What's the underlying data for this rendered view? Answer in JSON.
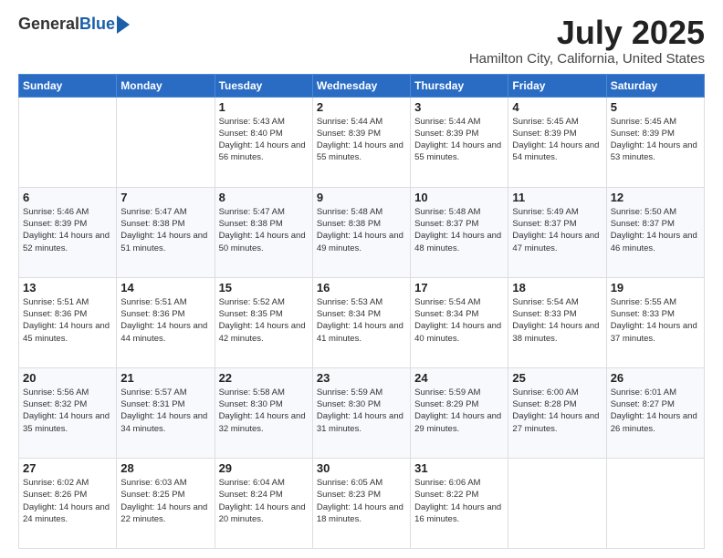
{
  "logo": {
    "general": "General",
    "blue": "Blue"
  },
  "header": {
    "month": "July 2025",
    "location": "Hamilton City, California, United States"
  },
  "weekdays": [
    "Sunday",
    "Monday",
    "Tuesday",
    "Wednesday",
    "Thursday",
    "Friday",
    "Saturday"
  ],
  "weeks": [
    [
      {
        "day": "",
        "sunrise": "",
        "sunset": "",
        "daylight": ""
      },
      {
        "day": "",
        "sunrise": "",
        "sunset": "",
        "daylight": ""
      },
      {
        "day": "1",
        "sunrise": "Sunrise: 5:43 AM",
        "sunset": "Sunset: 8:40 PM",
        "daylight": "Daylight: 14 hours and 56 minutes."
      },
      {
        "day": "2",
        "sunrise": "Sunrise: 5:44 AM",
        "sunset": "Sunset: 8:39 PM",
        "daylight": "Daylight: 14 hours and 55 minutes."
      },
      {
        "day": "3",
        "sunrise": "Sunrise: 5:44 AM",
        "sunset": "Sunset: 8:39 PM",
        "daylight": "Daylight: 14 hours and 55 minutes."
      },
      {
        "day": "4",
        "sunrise": "Sunrise: 5:45 AM",
        "sunset": "Sunset: 8:39 PM",
        "daylight": "Daylight: 14 hours and 54 minutes."
      },
      {
        "day": "5",
        "sunrise": "Sunrise: 5:45 AM",
        "sunset": "Sunset: 8:39 PM",
        "daylight": "Daylight: 14 hours and 53 minutes."
      }
    ],
    [
      {
        "day": "6",
        "sunrise": "Sunrise: 5:46 AM",
        "sunset": "Sunset: 8:39 PM",
        "daylight": "Daylight: 14 hours and 52 minutes."
      },
      {
        "day": "7",
        "sunrise": "Sunrise: 5:47 AM",
        "sunset": "Sunset: 8:38 PM",
        "daylight": "Daylight: 14 hours and 51 minutes."
      },
      {
        "day": "8",
        "sunrise": "Sunrise: 5:47 AM",
        "sunset": "Sunset: 8:38 PM",
        "daylight": "Daylight: 14 hours and 50 minutes."
      },
      {
        "day": "9",
        "sunrise": "Sunrise: 5:48 AM",
        "sunset": "Sunset: 8:38 PM",
        "daylight": "Daylight: 14 hours and 49 minutes."
      },
      {
        "day": "10",
        "sunrise": "Sunrise: 5:48 AM",
        "sunset": "Sunset: 8:37 PM",
        "daylight": "Daylight: 14 hours and 48 minutes."
      },
      {
        "day": "11",
        "sunrise": "Sunrise: 5:49 AM",
        "sunset": "Sunset: 8:37 PM",
        "daylight": "Daylight: 14 hours and 47 minutes."
      },
      {
        "day": "12",
        "sunrise": "Sunrise: 5:50 AM",
        "sunset": "Sunset: 8:37 PM",
        "daylight": "Daylight: 14 hours and 46 minutes."
      }
    ],
    [
      {
        "day": "13",
        "sunrise": "Sunrise: 5:51 AM",
        "sunset": "Sunset: 8:36 PM",
        "daylight": "Daylight: 14 hours and 45 minutes."
      },
      {
        "day": "14",
        "sunrise": "Sunrise: 5:51 AM",
        "sunset": "Sunset: 8:36 PM",
        "daylight": "Daylight: 14 hours and 44 minutes."
      },
      {
        "day": "15",
        "sunrise": "Sunrise: 5:52 AM",
        "sunset": "Sunset: 8:35 PM",
        "daylight": "Daylight: 14 hours and 42 minutes."
      },
      {
        "day": "16",
        "sunrise": "Sunrise: 5:53 AM",
        "sunset": "Sunset: 8:34 PM",
        "daylight": "Daylight: 14 hours and 41 minutes."
      },
      {
        "day": "17",
        "sunrise": "Sunrise: 5:54 AM",
        "sunset": "Sunset: 8:34 PM",
        "daylight": "Daylight: 14 hours and 40 minutes."
      },
      {
        "day": "18",
        "sunrise": "Sunrise: 5:54 AM",
        "sunset": "Sunset: 8:33 PM",
        "daylight": "Daylight: 14 hours and 38 minutes."
      },
      {
        "day": "19",
        "sunrise": "Sunrise: 5:55 AM",
        "sunset": "Sunset: 8:33 PM",
        "daylight": "Daylight: 14 hours and 37 minutes."
      }
    ],
    [
      {
        "day": "20",
        "sunrise": "Sunrise: 5:56 AM",
        "sunset": "Sunset: 8:32 PM",
        "daylight": "Daylight: 14 hours and 35 minutes."
      },
      {
        "day": "21",
        "sunrise": "Sunrise: 5:57 AM",
        "sunset": "Sunset: 8:31 PM",
        "daylight": "Daylight: 14 hours and 34 minutes."
      },
      {
        "day": "22",
        "sunrise": "Sunrise: 5:58 AM",
        "sunset": "Sunset: 8:30 PM",
        "daylight": "Daylight: 14 hours and 32 minutes."
      },
      {
        "day": "23",
        "sunrise": "Sunrise: 5:59 AM",
        "sunset": "Sunset: 8:30 PM",
        "daylight": "Daylight: 14 hours and 31 minutes."
      },
      {
        "day": "24",
        "sunrise": "Sunrise: 5:59 AM",
        "sunset": "Sunset: 8:29 PM",
        "daylight": "Daylight: 14 hours and 29 minutes."
      },
      {
        "day": "25",
        "sunrise": "Sunrise: 6:00 AM",
        "sunset": "Sunset: 8:28 PM",
        "daylight": "Daylight: 14 hours and 27 minutes."
      },
      {
        "day": "26",
        "sunrise": "Sunrise: 6:01 AM",
        "sunset": "Sunset: 8:27 PM",
        "daylight": "Daylight: 14 hours and 26 minutes."
      }
    ],
    [
      {
        "day": "27",
        "sunrise": "Sunrise: 6:02 AM",
        "sunset": "Sunset: 8:26 PM",
        "daylight": "Daylight: 14 hours and 24 minutes."
      },
      {
        "day": "28",
        "sunrise": "Sunrise: 6:03 AM",
        "sunset": "Sunset: 8:25 PM",
        "daylight": "Daylight: 14 hours and 22 minutes."
      },
      {
        "day": "29",
        "sunrise": "Sunrise: 6:04 AM",
        "sunset": "Sunset: 8:24 PM",
        "daylight": "Daylight: 14 hours and 20 minutes."
      },
      {
        "day": "30",
        "sunrise": "Sunrise: 6:05 AM",
        "sunset": "Sunset: 8:23 PM",
        "daylight": "Daylight: 14 hours and 18 minutes."
      },
      {
        "day": "31",
        "sunrise": "Sunrise: 6:06 AM",
        "sunset": "Sunset: 8:22 PM",
        "daylight": "Daylight: 14 hours and 16 minutes."
      },
      {
        "day": "",
        "sunrise": "",
        "sunset": "",
        "daylight": ""
      },
      {
        "day": "",
        "sunrise": "",
        "sunset": "",
        "daylight": ""
      }
    ]
  ]
}
